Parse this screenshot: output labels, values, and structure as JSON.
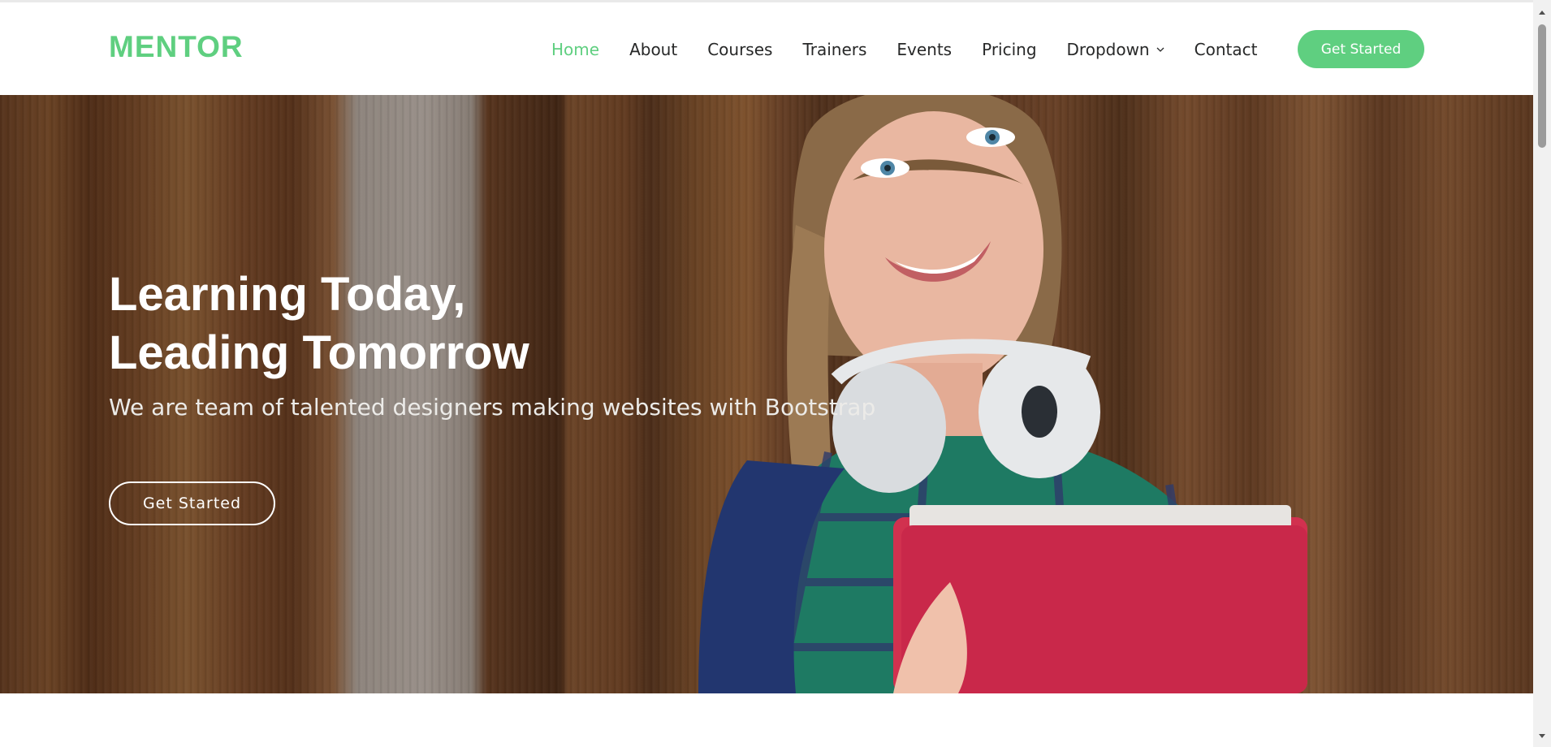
{
  "header": {
    "logo": "MENTOR",
    "nav": [
      {
        "label": "Home",
        "active": true
      },
      {
        "label": "About"
      },
      {
        "label": "Courses"
      },
      {
        "label": "Trainers"
      },
      {
        "label": "Events"
      },
      {
        "label": "Pricing"
      },
      {
        "label": "Dropdown",
        "icon": "chevron-down-icon"
      },
      {
        "label": "Contact"
      }
    ],
    "cta_label": "Get Started"
  },
  "hero": {
    "title_line1": "Learning Today,",
    "title_line2": "Leading Tomorrow",
    "subtitle": "We are team of talented designers making websites with Bootstrap",
    "button_label": "Get Started"
  },
  "colors": {
    "accent": "#5fcf80",
    "text": "#272828",
    "white": "#ffffff"
  }
}
